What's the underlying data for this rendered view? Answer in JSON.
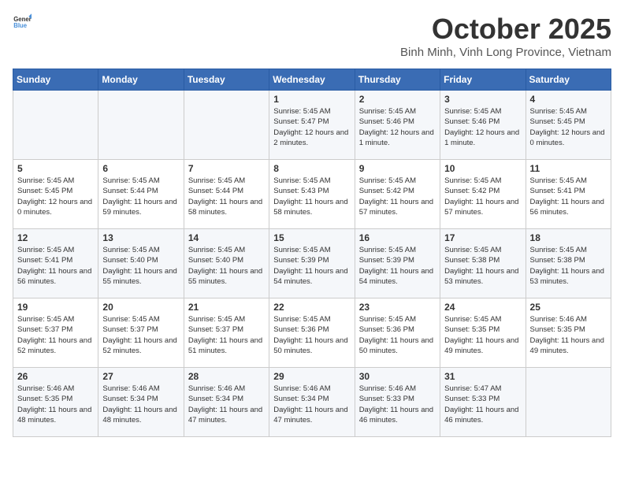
{
  "header": {
    "logo_general": "General",
    "logo_blue": "Blue",
    "month": "October 2025",
    "location": "Binh Minh, Vinh Long Province, Vietnam"
  },
  "days_of_week": [
    "Sunday",
    "Monday",
    "Tuesday",
    "Wednesday",
    "Thursday",
    "Friday",
    "Saturday"
  ],
  "weeks": [
    [
      {
        "day": "",
        "text": ""
      },
      {
        "day": "",
        "text": ""
      },
      {
        "day": "",
        "text": ""
      },
      {
        "day": "1",
        "text": "Sunrise: 5:45 AM\nSunset: 5:47 PM\nDaylight: 12 hours and 2 minutes."
      },
      {
        "day": "2",
        "text": "Sunrise: 5:45 AM\nSunset: 5:46 PM\nDaylight: 12 hours and 1 minute."
      },
      {
        "day": "3",
        "text": "Sunrise: 5:45 AM\nSunset: 5:46 PM\nDaylight: 12 hours and 1 minute."
      },
      {
        "day": "4",
        "text": "Sunrise: 5:45 AM\nSunset: 5:45 PM\nDaylight: 12 hours and 0 minutes."
      }
    ],
    [
      {
        "day": "5",
        "text": "Sunrise: 5:45 AM\nSunset: 5:45 PM\nDaylight: 12 hours and 0 minutes."
      },
      {
        "day": "6",
        "text": "Sunrise: 5:45 AM\nSunset: 5:44 PM\nDaylight: 11 hours and 59 minutes."
      },
      {
        "day": "7",
        "text": "Sunrise: 5:45 AM\nSunset: 5:44 PM\nDaylight: 11 hours and 58 minutes."
      },
      {
        "day": "8",
        "text": "Sunrise: 5:45 AM\nSunset: 5:43 PM\nDaylight: 11 hours and 58 minutes."
      },
      {
        "day": "9",
        "text": "Sunrise: 5:45 AM\nSunset: 5:42 PM\nDaylight: 11 hours and 57 minutes."
      },
      {
        "day": "10",
        "text": "Sunrise: 5:45 AM\nSunset: 5:42 PM\nDaylight: 11 hours and 57 minutes."
      },
      {
        "day": "11",
        "text": "Sunrise: 5:45 AM\nSunset: 5:41 PM\nDaylight: 11 hours and 56 minutes."
      }
    ],
    [
      {
        "day": "12",
        "text": "Sunrise: 5:45 AM\nSunset: 5:41 PM\nDaylight: 11 hours and 56 minutes."
      },
      {
        "day": "13",
        "text": "Sunrise: 5:45 AM\nSunset: 5:40 PM\nDaylight: 11 hours and 55 minutes."
      },
      {
        "day": "14",
        "text": "Sunrise: 5:45 AM\nSunset: 5:40 PM\nDaylight: 11 hours and 55 minutes."
      },
      {
        "day": "15",
        "text": "Sunrise: 5:45 AM\nSunset: 5:39 PM\nDaylight: 11 hours and 54 minutes."
      },
      {
        "day": "16",
        "text": "Sunrise: 5:45 AM\nSunset: 5:39 PM\nDaylight: 11 hours and 54 minutes."
      },
      {
        "day": "17",
        "text": "Sunrise: 5:45 AM\nSunset: 5:38 PM\nDaylight: 11 hours and 53 minutes."
      },
      {
        "day": "18",
        "text": "Sunrise: 5:45 AM\nSunset: 5:38 PM\nDaylight: 11 hours and 53 minutes."
      }
    ],
    [
      {
        "day": "19",
        "text": "Sunrise: 5:45 AM\nSunset: 5:37 PM\nDaylight: 11 hours and 52 minutes."
      },
      {
        "day": "20",
        "text": "Sunrise: 5:45 AM\nSunset: 5:37 PM\nDaylight: 11 hours and 52 minutes."
      },
      {
        "day": "21",
        "text": "Sunrise: 5:45 AM\nSunset: 5:37 PM\nDaylight: 11 hours and 51 minutes."
      },
      {
        "day": "22",
        "text": "Sunrise: 5:45 AM\nSunset: 5:36 PM\nDaylight: 11 hours and 50 minutes."
      },
      {
        "day": "23",
        "text": "Sunrise: 5:45 AM\nSunset: 5:36 PM\nDaylight: 11 hours and 50 minutes."
      },
      {
        "day": "24",
        "text": "Sunrise: 5:45 AM\nSunset: 5:35 PM\nDaylight: 11 hours and 49 minutes."
      },
      {
        "day": "25",
        "text": "Sunrise: 5:46 AM\nSunset: 5:35 PM\nDaylight: 11 hours and 49 minutes."
      }
    ],
    [
      {
        "day": "26",
        "text": "Sunrise: 5:46 AM\nSunset: 5:35 PM\nDaylight: 11 hours and 48 minutes."
      },
      {
        "day": "27",
        "text": "Sunrise: 5:46 AM\nSunset: 5:34 PM\nDaylight: 11 hours and 48 minutes."
      },
      {
        "day": "28",
        "text": "Sunrise: 5:46 AM\nSunset: 5:34 PM\nDaylight: 11 hours and 47 minutes."
      },
      {
        "day": "29",
        "text": "Sunrise: 5:46 AM\nSunset: 5:34 PM\nDaylight: 11 hours and 47 minutes."
      },
      {
        "day": "30",
        "text": "Sunrise: 5:46 AM\nSunset: 5:33 PM\nDaylight: 11 hours and 46 minutes."
      },
      {
        "day": "31",
        "text": "Sunrise: 5:47 AM\nSunset: 5:33 PM\nDaylight: 11 hours and 46 minutes."
      },
      {
        "day": "",
        "text": ""
      }
    ]
  ]
}
